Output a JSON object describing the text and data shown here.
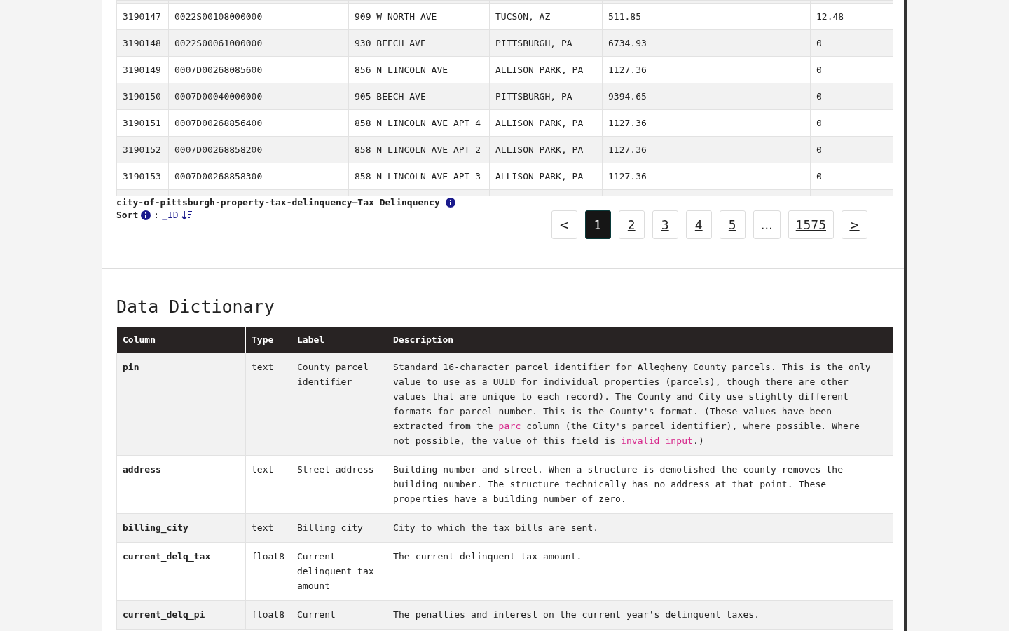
{
  "records": {
    "rows": [
      {
        "cells": [
          "3190147",
          "0022S00108000000",
          "909 W NORTH AVE",
          "TUCSON, AZ",
          "511.85",
          "12.48"
        ]
      },
      {
        "cells": [
          "3190148",
          "0022S00061000000",
          "930 BEECH AVE",
          "PITTSBURGH, PA",
          "6734.93",
          "0"
        ]
      },
      {
        "cells": [
          "3190149",
          "0007D00268085600",
          "856 N LINCOLN AVE",
          "ALLISON PARK, PA",
          "1127.36",
          "0"
        ]
      },
      {
        "cells": [
          "3190150",
          "0007D00040000000",
          "905 BEECH AVE",
          "PITTSBURGH, PA",
          "9394.65",
          "0"
        ]
      },
      {
        "cells": [
          "3190151",
          "0007D00268856400",
          "858 N LINCOLN AVE APT 4",
          "ALLISON PARK, PA",
          "1127.36",
          "0"
        ]
      },
      {
        "cells": [
          "3190152",
          "0007D00268858200",
          "858 N LINCOLN AVE APT 2",
          "ALLISON PARK, PA",
          "1127.36",
          "0"
        ]
      },
      {
        "cells": [
          "3190153",
          "0007D00268858300",
          "858 N LINCOLN AVE APT 3",
          "ALLISON PARK, PA",
          "1127.36",
          "0"
        ]
      }
    ],
    "caption": "city-of-pittsburgh-property-tax-delinquency—Tax Delinquency",
    "sort": {
      "label": "Sort",
      "separator": ":",
      "field": "_ID"
    },
    "pagination": [
      {
        "label": "<",
        "kind": "nav",
        "selected": false
      },
      {
        "label": "1",
        "kind": "page",
        "selected": true
      },
      {
        "label": "2",
        "kind": "page",
        "selected": false
      },
      {
        "label": "3",
        "kind": "page",
        "selected": false
      },
      {
        "label": "4",
        "kind": "page",
        "selected": false
      },
      {
        "label": "5",
        "kind": "page",
        "selected": false
      },
      {
        "label": "…",
        "kind": "gap",
        "selected": false
      },
      {
        "label": "1575",
        "kind": "page",
        "selected": false
      },
      {
        "label": ">",
        "kind": "next",
        "selected": false
      }
    ]
  },
  "data_dictionary": {
    "title": "Data Dictionary",
    "columns": [
      "Column",
      "Type",
      "Label",
      "Description"
    ],
    "rows": [
      {
        "column": "pin",
        "type": "text",
        "label": "County parcel identifier",
        "description": [
          {
            "kind": "text",
            "text": "Standard 16-character parcel identifier for Allegheny County parcels. This is the only value to use as a UUID for individual properties (parcels), though there are other values that are unique to each record). The County and City use slightly different formats for parcel number. This is the County's format. (These values have been extracted from the "
          },
          {
            "kind": "code",
            "text": "parc"
          },
          {
            "kind": "text",
            "text": " column (the City's parcel identifier), where possible. Where not possible, the value of this field is "
          },
          {
            "kind": "code",
            "text": "invalid input"
          },
          {
            "kind": "text",
            "text": ".)"
          }
        ]
      },
      {
        "column": "address",
        "type": "text",
        "label": "Street address",
        "description": [
          {
            "kind": "text",
            "text": "Building number and street. When a structure is demolished the county removes the building number. The structure technically has no address at that point. These properties have a building number of zero."
          }
        ]
      },
      {
        "column": "billing_city",
        "type": "text",
        "label": "Billing city",
        "description": [
          {
            "kind": "text",
            "text": "City to which the tax bills are sent."
          }
        ]
      },
      {
        "column": "current_delq_tax",
        "type": "float8",
        "label": "Current delinquent tax amount",
        "description": [
          {
            "kind": "text",
            "text": "The current delinquent tax amount."
          }
        ]
      },
      {
        "column": "current_delq_pi",
        "type": "float8",
        "label": "Current",
        "description": [
          {
            "kind": "text",
            "text": "The penalties and interest on the current year's delinquent taxes."
          }
        ]
      }
    ]
  }
}
